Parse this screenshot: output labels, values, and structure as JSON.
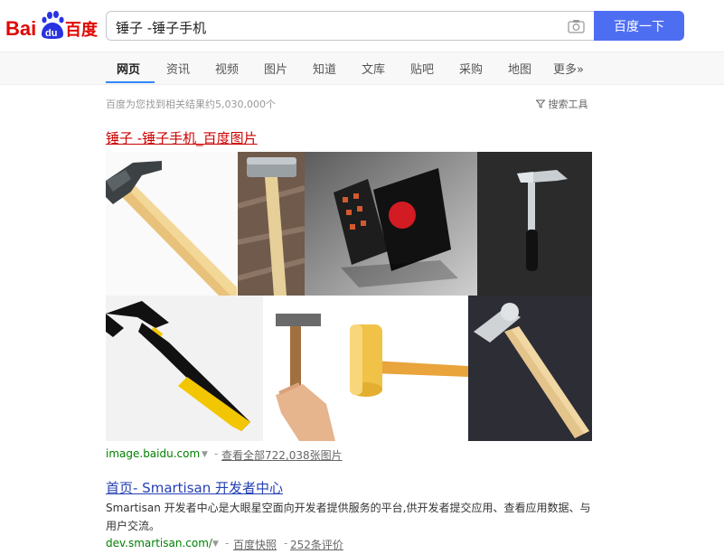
{
  "header": {
    "logo_text_bai": "Bai",
    "logo_text_du": "du",
    "logo_text_cn": "百度",
    "search_value": "锤子 -锤子手机",
    "search_button": "百度一下"
  },
  "tabs": [
    {
      "label": "网页",
      "active": true
    },
    {
      "label": "资讯"
    },
    {
      "label": "视频"
    },
    {
      "label": "图片"
    },
    {
      "label": "知道"
    },
    {
      "label": "文库"
    },
    {
      "label": "贴吧"
    },
    {
      "label": "采购"
    },
    {
      "label": "地图"
    },
    {
      "label": "更多»"
    }
  ],
  "results_info": {
    "count_text": "百度为您找到相关结果约5,030,000个",
    "tools_text": "搜索工具"
  },
  "result1": {
    "title": "锤子 -锤子手机_百度图片",
    "source": "image.baidu.com",
    "view_all": "查看全部722,038张图片"
  },
  "result2": {
    "title": "首页- Smartisan 开发者中心",
    "description": "Smartisan 开发者中心是大眼星空面向开发者提供服务的平台,供开发者提交应用、查看应用数据、与用户交流。",
    "source": "dev.smartisan.com/",
    "cache": "百度快照",
    "reviews": "252条评价"
  },
  "colors": {
    "accent": "#4e6ef2",
    "title_red": "#cc0000",
    "title_blue": "#2440b3",
    "url_green": "#008000"
  },
  "icons": [
    "camera-icon",
    "filter-icon",
    "dropdown-arrow-icon",
    "baidu-paw-icon"
  ]
}
